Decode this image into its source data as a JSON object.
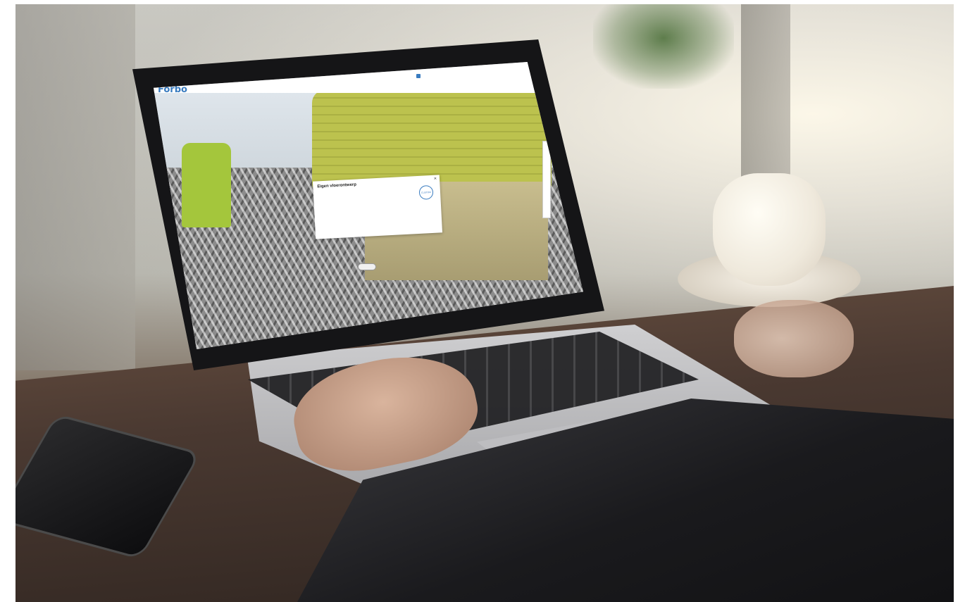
{
  "scene": "photo",
  "laptop_screen": {
    "brand_logo": "Forbo",
    "nav": {
      "items": [
        "",
        "",
        "",
        "",
        ""
      ]
    },
    "side_tab_label": "",
    "popup": {
      "title": "Eigen vloerontwerp",
      "body": "",
      "close_icon": "close-icon",
      "badge": "CUSTOM"
    },
    "pill_button": ""
  }
}
